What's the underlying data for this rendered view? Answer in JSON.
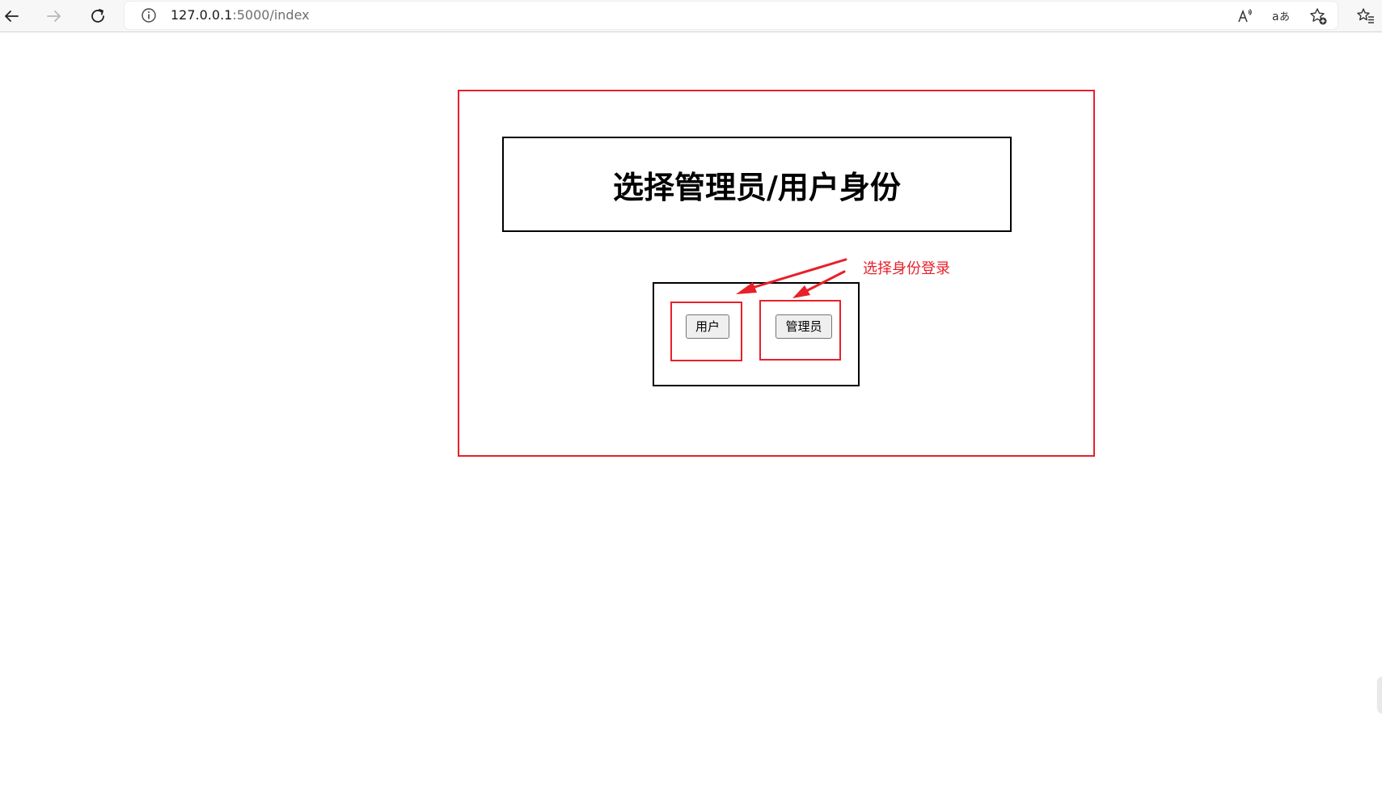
{
  "browser": {
    "url_host": "127.0.0.1",
    "url_path": ":5000/index",
    "icons": {
      "back": "back-arrow-icon",
      "forward": "forward-arrow-icon",
      "reload": "reload-icon",
      "info": "info-icon",
      "read_aloud": "read-aloud-icon",
      "translate": "translate-icon",
      "favorite_add": "favorite-add-icon",
      "favorites": "favorites-icon"
    }
  },
  "page": {
    "title": "选择管理员/用户身份",
    "buttons": {
      "user_label": "用户",
      "admin_label": "管理员"
    }
  },
  "annotation": {
    "text": "选择身份登录",
    "color": "#e8202a"
  }
}
